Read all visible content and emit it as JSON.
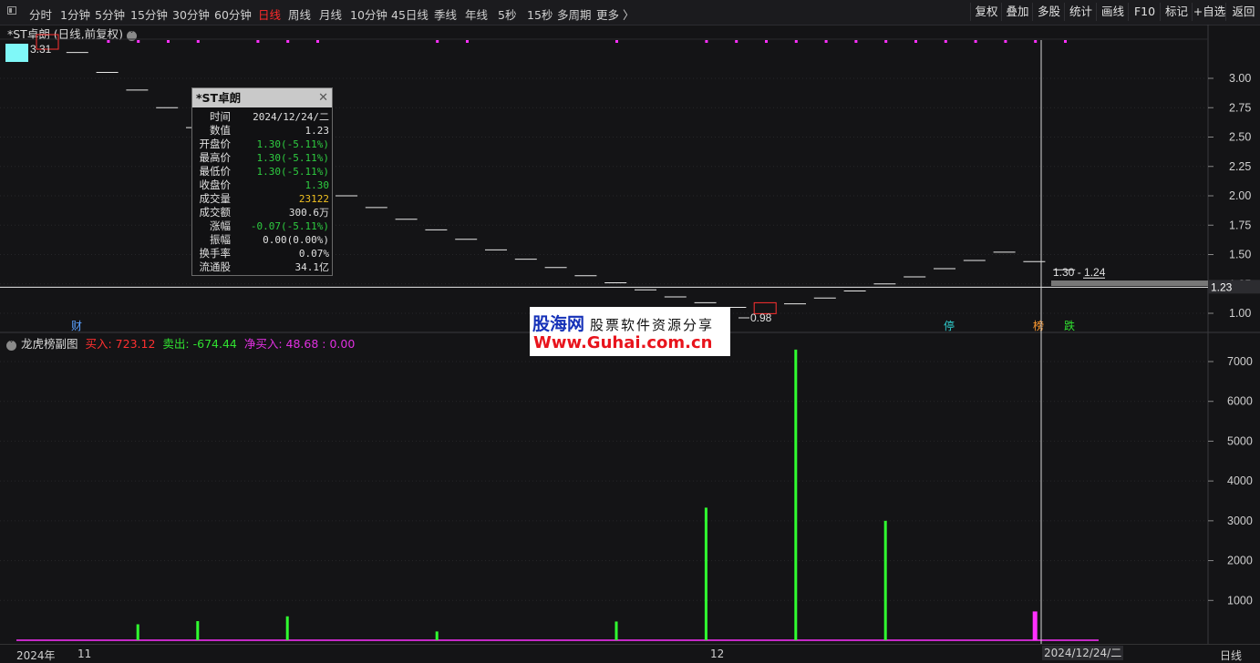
{
  "toolbar": {
    "left": [
      "分时",
      "1分钟",
      "5分钟",
      "15分钟",
      "30分钟",
      "60分钟",
      "日线",
      "周线",
      "月线",
      "10分钟",
      "45日线",
      "季线",
      "年线",
      "5秒",
      "15秒",
      "多周期",
      "更多 〉"
    ],
    "active": "日线",
    "right": [
      "复权",
      "叠加",
      "多股",
      "统计",
      "画线",
      "F10",
      "标记",
      "+自选",
      "返回"
    ]
  },
  "main_title": "*ST卓朗 (日线,前复权)",
  "sub_title": {
    "name": "龙虎榜副图",
    "buy": "买入: 723.12",
    "sell": "卖出: -674.44",
    "net": "净买入: 48.68 : 0.00"
  },
  "annotations": {
    "high": "3.31",
    "low": "0.98",
    "range": "1.30 - 1.24",
    "cursor_price": "1.23",
    "tags": [
      {
        "text": "财",
        "color": "#5aa0ff"
      },
      {
        "text": "停",
        "color": "#30d0d0"
      },
      {
        "text": "榜",
        "color": "#ff9a30"
      },
      {
        "text": "跌",
        "color": "#30e030"
      }
    ]
  },
  "tooltip": {
    "title": "*ST卓朗",
    "rows": [
      {
        "k": "时间",
        "v": "2024/12/24/二",
        "c": "#e0e0e0"
      },
      {
        "k": "数值",
        "v": "1.23",
        "c": "#e0e0e0"
      },
      {
        "k": "开盘价",
        "v": "1.30(-5.11%)",
        "c": "#2ecc40"
      },
      {
        "k": "最高价",
        "v": "1.30(-5.11%)",
        "c": "#2ecc40"
      },
      {
        "k": "最低价",
        "v": "1.30(-5.11%)",
        "c": "#2ecc40"
      },
      {
        "k": "收盘价",
        "v": "1.30",
        "c": "#2ecc40"
      },
      {
        "k": "成交量",
        "v": "23122",
        "c": "#f0c020"
      },
      {
        "k": "成交额",
        "v": "300.6万",
        "c": "#e0e0e0"
      },
      {
        "k": "涨幅",
        "v": "-0.07(-5.11%)",
        "c": "#2ecc40"
      },
      {
        "k": "振幅",
        "v": "0.00(0.00%)",
        "c": "#e0e0e0"
      },
      {
        "k": "换手率",
        "v": "0.07%",
        "c": "#e0e0e0"
      },
      {
        "k": "流通股",
        "v": "34.1亿",
        "c": "#e0e0e0"
      }
    ]
  },
  "watermark": {
    "line1": "股海网",
    "line1b": "股票软件资源分享",
    "line2": "Www.Guhai.com.cn"
  },
  "x_axis": {
    "labels": [
      "2024年",
      "11",
      "12"
    ],
    "cursor_date": "2024/12/24/二",
    "period": "日线"
  },
  "colors": {
    "up": "#ff3030",
    "down": "#30ff30",
    "marker": "#ff30ff",
    "bg": "#141416"
  },
  "chart_data": [
    {
      "type": "candlestick",
      "title": "*ST卓朗 (日线,前复权)",
      "y_ticks": [
        1.0,
        1.25,
        1.5,
        1.75,
        2.0,
        2.25,
        2.5,
        2.75,
        3.0
      ],
      "ylim": [
        0.88,
        3.3
      ],
      "close": [
        3.31,
        3.22,
        3.05,
        2.9,
        2.75,
        2.58,
        2.47,
        2.34,
        2.22,
        2.11,
        2.0,
        1.9,
        1.8,
        1.71,
        1.63,
        1.54,
        1.46,
        1.39,
        1.32,
        1.26,
        1.2,
        1.14,
        1.09,
        1.05,
        1.03,
        1.08,
        1.13,
        1.19,
        1.25,
        1.31,
        1.38,
        1.45,
        1.52,
        1.44,
        1.37,
        1.3,
        1.24
      ],
      "high_label": 3.31,
      "low_label": 0.98,
      "current": 1.23,
      "range_label": "1.30 - 1.24"
    },
    {
      "type": "bar",
      "title": "龙虎榜副图",
      "y_ticks": [
        1000,
        2000,
        3000,
        4000,
        5000,
        6000,
        7000
      ],
      "ylim": [
        0,
        7400
      ],
      "bars": [
        {
          "i": 4,
          "value": 400,
          "color": "#30ff30"
        },
        {
          "i": 6,
          "value": 480,
          "color": "#30ff30"
        },
        {
          "i": 9,
          "value": 600,
          "color": "#30ff30"
        },
        {
          "i": 14,
          "value": 220,
          "color": "#30ff30"
        },
        {
          "i": 20,
          "value": 470,
          "color": "#30ff30"
        },
        {
          "i": 23,
          "value": 3330,
          "color": "#30ff30"
        },
        {
          "i": 26,
          "value": 7300,
          "color": "#30ff30"
        },
        {
          "i": 29,
          "value": 3000,
          "color": "#30ff30"
        },
        {
          "i": 34,
          "value": 723,
          "color": "#ff30ff"
        }
      ]
    }
  ]
}
